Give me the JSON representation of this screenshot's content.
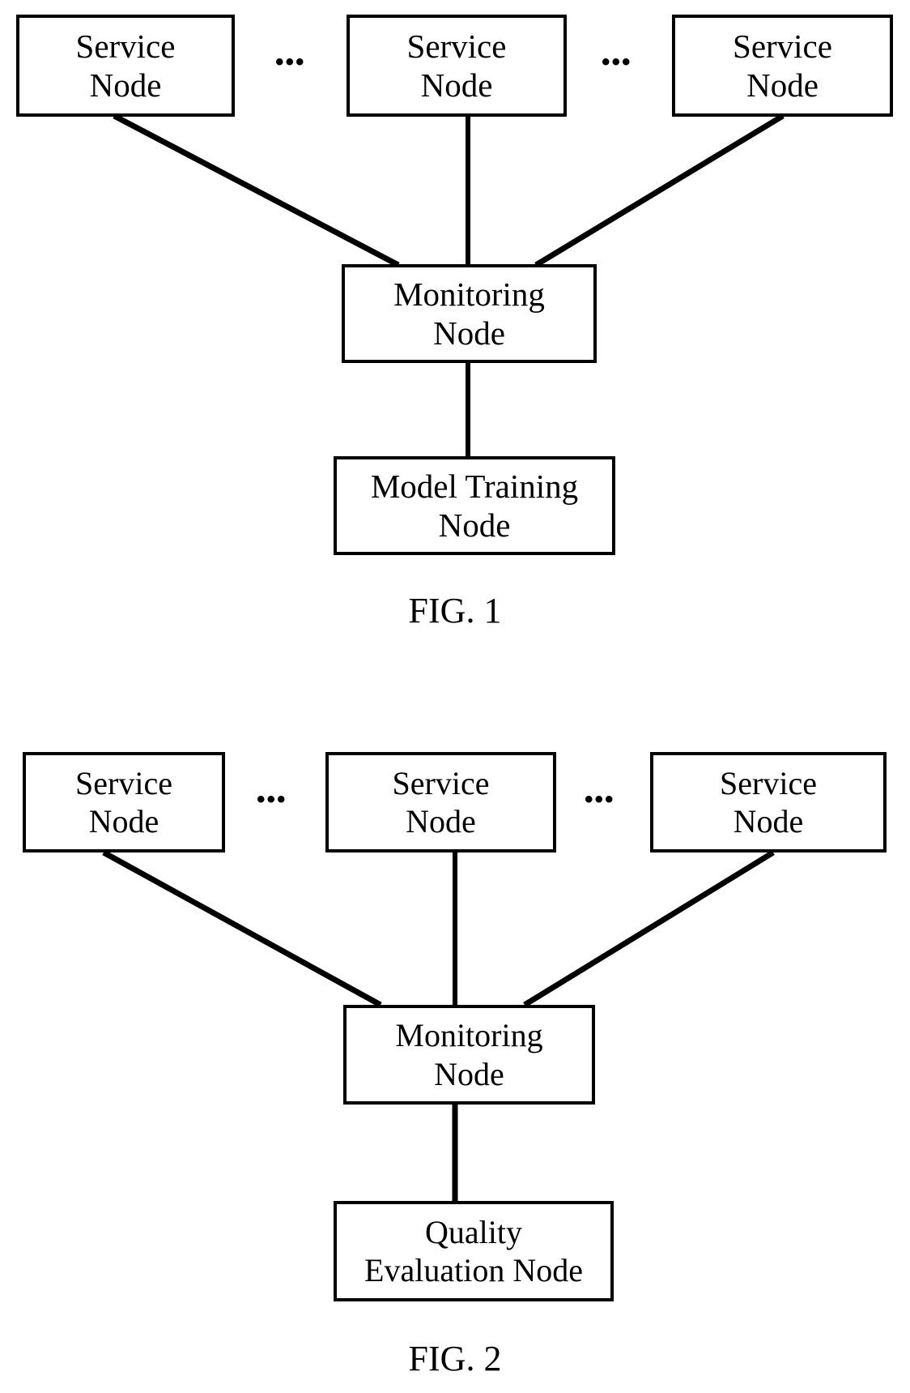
{
  "document": {
    "type": "patent-figure-sheet",
    "figure_count": 2
  },
  "figures": [
    {
      "id": "fig-1",
      "caption": "FIG. 1",
      "nodes": [
        {
          "id": "fig1-service-node-left",
          "line1": "Service",
          "line2": "Node"
        },
        {
          "id": "fig1-service-node-middle",
          "line1": "Service",
          "line2": "Node"
        },
        {
          "id": "fig1-service-node-right",
          "line1": "Service",
          "line2": "Node"
        },
        {
          "id": "fig1-monitoring-node",
          "line1": "Monitoring",
          "line2": "Node"
        },
        {
          "id": "fig1-model-training-node",
          "line1": "Model Training",
          "line2": "Node"
        }
      ],
      "ellipses": [
        {
          "id": "fig1-ellipsis-left",
          "text": "•••"
        },
        {
          "id": "fig1-ellipsis-right",
          "text": "•••"
        }
      ]
    },
    {
      "id": "fig-2",
      "caption": "FIG. 2",
      "nodes": [
        {
          "id": "fig2-service-node-left",
          "line1": "Service",
          "line2": "Node"
        },
        {
          "id": "fig2-service-node-middle",
          "line1": "Service",
          "line2": "Node"
        },
        {
          "id": "fig2-service-node-right",
          "line1": "Service",
          "line2": "Node"
        },
        {
          "id": "fig2-monitoring-node",
          "line1": "Monitoring",
          "line2": "Node"
        },
        {
          "id": "fig2-quality-evaluation-node",
          "line1": "Quality",
          "line2": "Evaluation Node"
        }
      ],
      "ellipses": [
        {
          "id": "fig2-ellipsis-left",
          "text": "•••"
        },
        {
          "id": "fig2-ellipsis-right",
          "text": "•••"
        }
      ]
    }
  ],
  "style": {
    "stroke_color": "#000000",
    "background_color": "#ffffff",
    "text_color": "#000000"
  }
}
